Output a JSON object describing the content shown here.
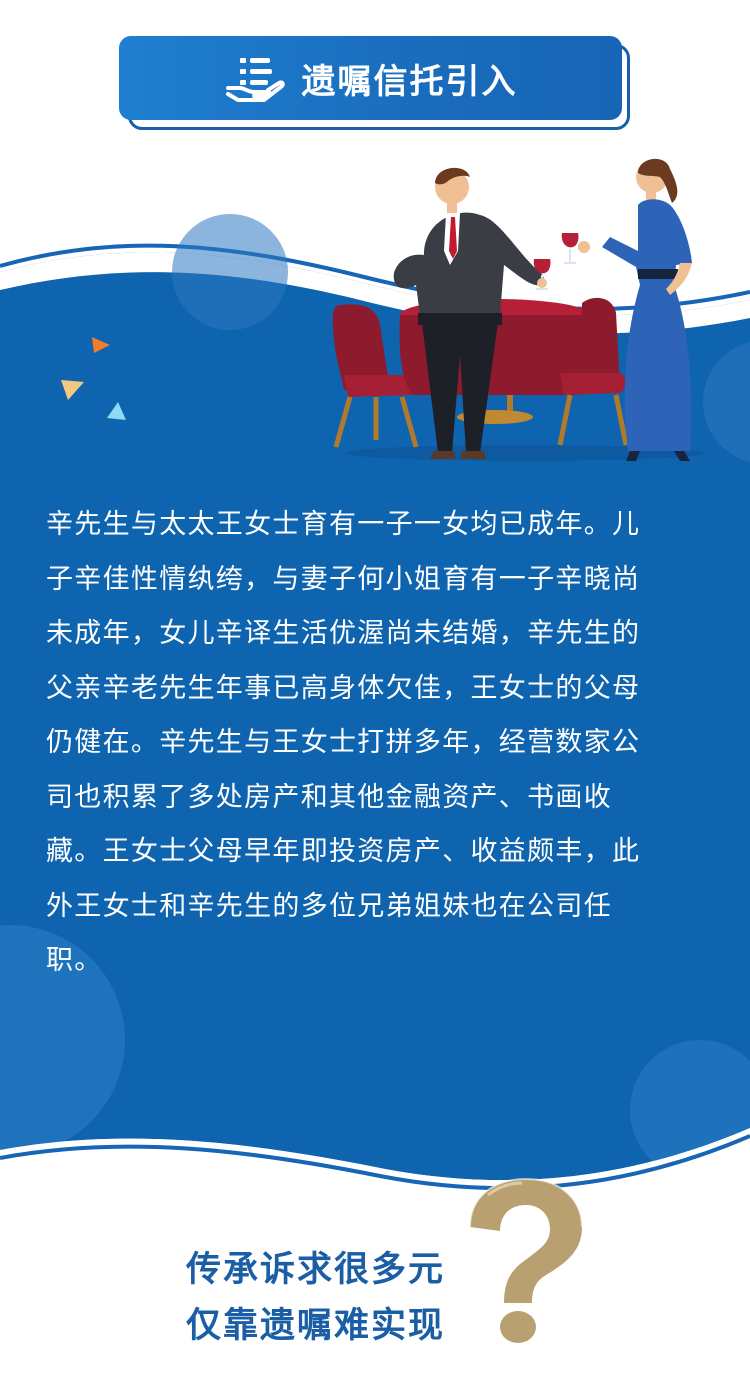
{
  "header": {
    "title": "遗嘱信托引入",
    "icon": "hand-list-icon"
  },
  "illustration": {
    "name": "couple-toasting-wine-icon"
  },
  "story": {
    "lines": [
      "辛先生与太太王女士育有一子一女均已成年。儿",
      "子辛佳性情纨绔，与妻子何小姐育有一子辛晓尚",
      "未成年，女儿辛译生活优渥尚未结婚，辛先生的",
      "父亲辛老先生年事已高身体欠佳，王女士的父母",
      "仍健在。辛先生与王女士打拼多年，经营数家公",
      "司也积累了多处房产和其他金融资产、书画收",
      "藏。王女士父母早年即投资房产、收益颇丰，此",
      "外王女士和辛先生的多位兄弟姐妹也在公司任",
      "职。"
    ]
  },
  "slogan": {
    "line1": "传承诉求很多元",
    "line2": "仅靠遗嘱难实现",
    "icon": "question-mark-icon"
  },
  "colors": {
    "primary_blue": "#1765b6",
    "deep_blue": "#0f5aa5",
    "light_blue": "#3a86cc",
    "gold": "#b9a071",
    "slogan_blue": "#1a5ea6"
  }
}
